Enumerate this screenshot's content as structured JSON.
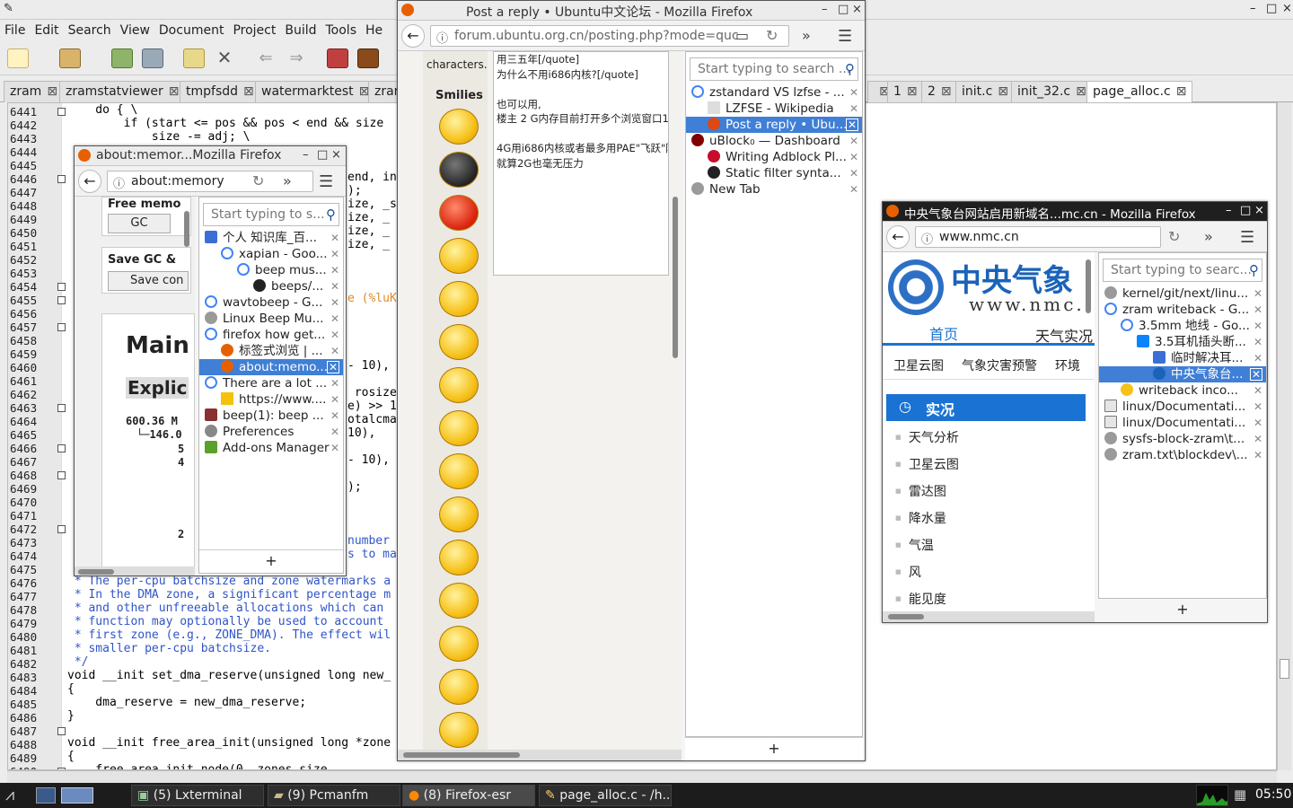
{
  "geany": {
    "menu": [
      "File",
      "Edit",
      "Search",
      "View",
      "Document",
      "Project",
      "Build",
      "Tools",
      "He"
    ],
    "tabs": [
      "zram",
      "zramstatviewer",
      "tmpfsdd",
      "watermarktest",
      "zran",
      "1",
      "2",
      "init.c",
      "init_32.c",
      "page_alloc.c"
    ],
    "line_numbers": [
      "6441",
      "6442",
      "6443",
      "6444",
      "6445",
      "6446",
      "6447",
      "6448",
      "6449",
      "6450",
      "6451",
      "6452",
      "6453",
      "6454",
      "6455",
      "6456",
      "6457",
      "6458",
      "6459",
      "6460",
      "6461",
      "6462",
      "6463",
      "6464",
      "6465",
      "6466",
      "6467",
      "6468",
      "6469",
      "6470",
      "6471",
      "6472",
      "6473",
      "6474",
      "6475",
      "6476",
      "6477",
      "6478",
      "6479",
      "6480",
      "6481",
      "6482",
      "6483",
      "6484",
      "6485",
      "6486",
      "6487",
      "6488",
      "6489",
      "6490"
    ],
    "code_top": [
      "    do { \\",
      "        if (start <= pos && pos < end && size",
      "            size -= adj; \\"
    ],
    "code_right": [
      "end, in",
      ");",
      "ize, _s",
      "ize, _",
      "ize, _",
      "ize, _",
      "e (%luK",
      "- 10),",
      " rosize",
      "e) >> 1",
      "otalcma",
      "10),",
      "- 10),",
      ");",
      "number",
      "s to ma"
    ],
    "code_bottom": [
      " * The per-cpu batchsize and zone watermarks a",
      " * In the DMA zone, a significant percentage m",
      " * and other unfreeable allocations which can",
      " * function may optionally be used to account",
      " * first zone (e.g., ZONE_DMA). The effect wil",
      " * smaller per-cpu batchsize.",
      " */",
      "void __init set_dma_reserve(unsigned long new_",
      "{",
      "    dma_reserve = new_dma_reserve;",
      "}",
      "",
      "void __init free_area_init(unsigned long *zone",
      "{",
      "    free_area_init_node(0, zones_size,"
    ]
  },
  "ff_memory": {
    "title": "about:memor...Mozilla Firefox",
    "url": "about:memory",
    "search_placeholder": "Start typing to s...",
    "content": {
      "free_memory": "Free memo",
      "gc": "GC",
      "save_gc": "Save GC &",
      "save_btn": "Save con",
      "main": "Main",
      "explicit": "Explic",
      "v1": "600.36 M",
      "v2": "146.0",
      "v3": "5",
      "v4": "4",
      "v5": "2"
    },
    "tree": [
      {
        "label": "个人 知识库_百...",
        "indent": 0,
        "icon": "paw"
      },
      {
        "label": "xapian - Goo...",
        "indent": 1,
        "icon": "g"
      },
      {
        "label": "beep mus...",
        "indent": 2,
        "icon": "g"
      },
      {
        "label": "beeps/...",
        "indent": 3,
        "icon": "gh"
      },
      {
        "label": "wavtobeep - G...",
        "indent": 0,
        "icon": "g"
      },
      {
        "label": "Linux Beep Mu...",
        "indent": 0,
        "icon": "globe"
      },
      {
        "label": "firefox how get...",
        "indent": 0,
        "icon": "g"
      },
      {
        "label": "标签式浏览 | ...",
        "indent": 1,
        "icon": "ff"
      },
      {
        "label": "about:memo...",
        "indent": 1,
        "icon": "ff",
        "selected": true
      },
      {
        "label": "There are a lot ...",
        "indent": 0,
        "icon": "g"
      },
      {
        "label": "https://www....",
        "indent": 1,
        "icon": "warn"
      },
      {
        "label": "beep(1): beep ...",
        "indent": 0,
        "icon": "book"
      },
      {
        "label": "Preferences",
        "indent": 0,
        "icon": "gear"
      },
      {
        "label": "Add-ons Manager",
        "indent": 0,
        "icon": "puzzle"
      }
    ],
    "add": "+"
  },
  "ff_ubuntu": {
    "title": "Post a reply • Ubuntu中文论坛 - Mozilla Firefox",
    "url": "forum.ubuntu.org.cn/posting.php?mode=quc",
    "chars": "characters.",
    "smilies": "Smilies",
    "post_lines": [
      "用三五年[/quote]",
      "为什么不用i686内核?[/quote]",
      "",
      "也可以用,",
      "楼主 2 G内存目前打开多个浏览窗口1",
      "",
      "4G用i686内核或者最多用PAE\"飞跃\"防",
      "就算2G也毫无压力"
    ],
    "search_placeholder": "Start typing to search ...",
    "tree": [
      {
        "label": "zstandard VS lzfse - ...",
        "indent": 0,
        "icon": "g"
      },
      {
        "label": "LZFSE - Wikipedia",
        "indent": 1,
        "icon": "w"
      },
      {
        "label": "Post a reply • Ubu...",
        "indent": 1,
        "icon": "ubuntu",
        "selected": true
      },
      {
        "label": "uBlock₀ — Dashboard",
        "indent": 0,
        "icon": "ublock"
      },
      {
        "label": "Writing Adblock Pl...",
        "indent": 1,
        "icon": "abp"
      },
      {
        "label": "Static filter synta...",
        "indent": 1,
        "icon": "gh"
      },
      {
        "label": "New Tab",
        "indent": 0,
        "icon": "globe"
      }
    ],
    "add": "+"
  },
  "ff_nmc": {
    "title": "中央气象台网站启用新域名...mc.cn - Mozilla Firefox",
    "url": "www.nmc.cn",
    "search_placeholder": "Start typing to searc...",
    "logo_cn": "中央气象",
    "logo_en": "www.nmc.",
    "nav": [
      "首页",
      "天气实况"
    ],
    "subnav": [
      "卫星云图",
      "气象灾害预警",
      "环境"
    ],
    "section": "实况",
    "menu": [
      "天气分析",
      "卫星云图",
      "雷达图",
      "降水量",
      "气温",
      "风",
      "能见度"
    ],
    "tree": [
      {
        "label": "kernel/git/next/linu...",
        "indent": 0,
        "icon": "globe"
      },
      {
        "label": "zram writeback - G...",
        "indent": 0,
        "icon": "g"
      },
      {
        "label": "3.5mm 地线 - Go...",
        "indent": 1,
        "icon": "g"
      },
      {
        "label": "3.5耳机插头断...",
        "indent": 2,
        "icon": "zhi"
      },
      {
        "label": "临时解决耳...",
        "indent": 3,
        "icon": "paw"
      },
      {
        "label": "中央气象台...",
        "indent": 3,
        "icon": "nmc",
        "selected": true
      },
      {
        "label": "writeback inco...",
        "indent": 1,
        "icon": "tux"
      },
      {
        "label": "linux/Documentati...",
        "indent": 0,
        "icon": "doc"
      },
      {
        "label": "linux/Documentati...",
        "indent": 0,
        "icon": "doc"
      },
      {
        "label": "sysfs-block-zram\\t...",
        "indent": 0,
        "icon": "globe"
      },
      {
        "label": "zram.txt\\blockdev\\...",
        "indent": 0,
        "icon": "globe"
      }
    ],
    "add": "+"
  },
  "taskbar": {
    "tasks": [
      "(5) Lxterminal",
      "(9) Pcmanfm",
      "(8) Firefox-esr",
      "page_alloc.c - /h..."
    ],
    "clock": "05:50"
  },
  "colors": {
    "selection": "#3f7fd6",
    "nmc_blue": "#1a73d2",
    "taskbar": "#1c1c1c"
  }
}
